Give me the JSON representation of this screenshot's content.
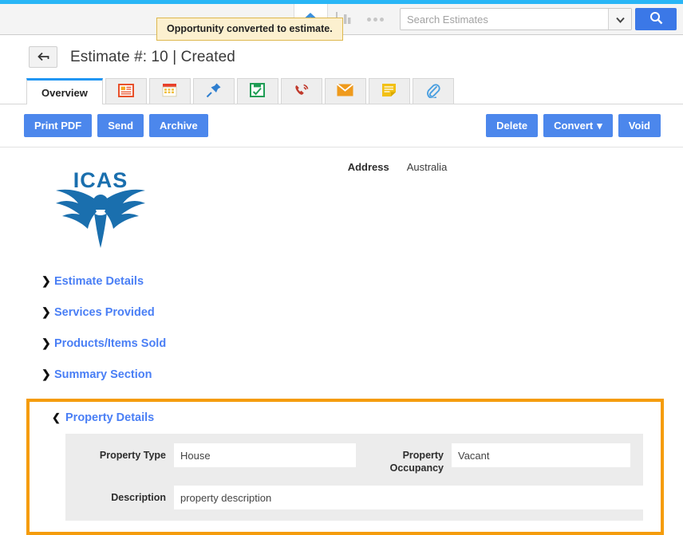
{
  "header": {
    "search": {
      "placeholder": "Search Estimates",
      "value": "",
      "caret_icon": "chevron-down-icon",
      "button_icon": "search-icon"
    },
    "nav_icons": [
      {
        "name": "home-icon",
        "active": true
      },
      {
        "name": "bar-chart-icon",
        "active": false
      },
      {
        "name": "more-dots-icon",
        "active": false
      }
    ]
  },
  "tooltip": {
    "text": "Opportunity converted to estimate."
  },
  "title_bar": {
    "back_icon": "back-arrow-icon",
    "title": "Estimate #: 10 | Created"
  },
  "tabs": [
    {
      "label": "Overview",
      "icon": "",
      "active": true
    },
    {
      "label": "",
      "icon": "document-icon",
      "active": false
    },
    {
      "label": "",
      "icon": "calendar-icon",
      "active": false
    },
    {
      "label": "",
      "icon": "pin-icon",
      "active": false
    },
    {
      "label": "",
      "icon": "task-checklist-icon",
      "active": false
    },
    {
      "label": "",
      "icon": "phone-icon",
      "active": false
    },
    {
      "label": "",
      "icon": "envelope-icon",
      "active": false
    },
    {
      "label": "",
      "icon": "note-icon",
      "active": false
    },
    {
      "label": "",
      "icon": "paperclip-icon",
      "active": false
    }
  ],
  "toolbar": {
    "left_buttons": [
      {
        "label": "Print PDF"
      },
      {
        "label": "Send"
      },
      {
        "label": "Archive"
      }
    ],
    "right_buttons": [
      {
        "label": "Delete"
      },
      {
        "label": "Convert",
        "caret": "▾"
      },
      {
        "label": "Void"
      }
    ]
  },
  "address": {
    "label": "Address",
    "value": "Australia"
  },
  "logo": {
    "name": "icas-logo",
    "text": "ICAS",
    "color": "#1a6fae"
  },
  "sections": [
    {
      "label": "Estimate Details",
      "expanded": false
    },
    {
      "label": "Services Provided",
      "expanded": false
    },
    {
      "label": "Products/Items Sold",
      "expanded": false
    },
    {
      "label": "Summary Section",
      "expanded": false
    }
  ],
  "property_details": {
    "label": "Property Details",
    "expanded": true,
    "highlight_color": "#f59c0b",
    "fields": [
      {
        "label": "Property Type",
        "value": "House"
      },
      {
        "label": "Property\nOccupancy",
        "label_line1": "Property",
        "label_line2": "Occupancy",
        "value": "Vacant"
      },
      {
        "label": "Description",
        "value": "property description"
      }
    ]
  },
  "colors": {
    "accent_blue": "#4c87ec",
    "link_blue": "#4a7ff5",
    "tab_active": "#2196f3",
    "top_strip": "#29b6f6",
    "highlight_orange": "#f59c0b",
    "tooltip_bg": "#fcf0cf"
  }
}
